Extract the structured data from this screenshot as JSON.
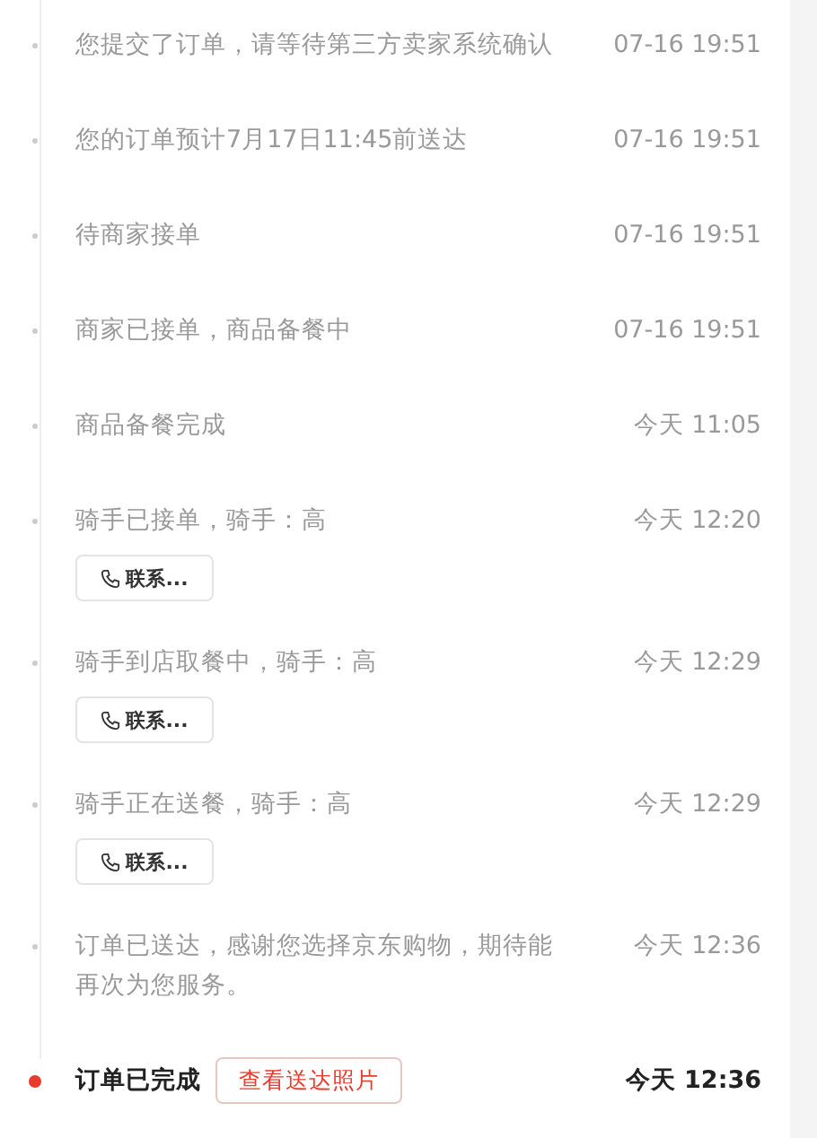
{
  "events": [
    {
      "text": "您提交了订单，请等待第三方卖家系统确认",
      "time": "07-16 19:51",
      "current": false
    },
    {
      "text": "您的订单预计7月17日11:45前送达",
      "time": "07-16 19:51",
      "current": false
    },
    {
      "text": "待商家接单",
      "time": "07-16 19:51",
      "current": false
    },
    {
      "text": "商家已接单，商品备餐中",
      "time": "07-16 19:51",
      "current": false
    },
    {
      "text": "商品备餐完成",
      "time": "今天 11:05",
      "current": false
    },
    {
      "text": "骑手已接单，骑手：高",
      "time": "今天 12:20",
      "current": false,
      "actions": [
        {
          "kind": "contact",
          "label": "联系..."
        }
      ]
    },
    {
      "text": "骑手到店取餐中，骑手：高",
      "time": "今天 12:29",
      "current": false,
      "actions": [
        {
          "kind": "contact",
          "label": "联系..."
        }
      ]
    },
    {
      "text": "骑手正在送餐，骑手：高",
      "time": "今天 12:29",
      "current": false,
      "actions": [
        {
          "kind": "contact",
          "label": "联系..."
        }
      ]
    },
    {
      "text": "订单已送达，感谢您选择京东购物，期待能再次为您服务。",
      "time": "今天 12:36",
      "current": false
    },
    {
      "text": "订单已完成",
      "time": "今天 12:36",
      "current": true,
      "inline_actions": [
        {
          "kind": "photo",
          "label": "查看送达照片"
        }
      ]
    }
  ]
}
